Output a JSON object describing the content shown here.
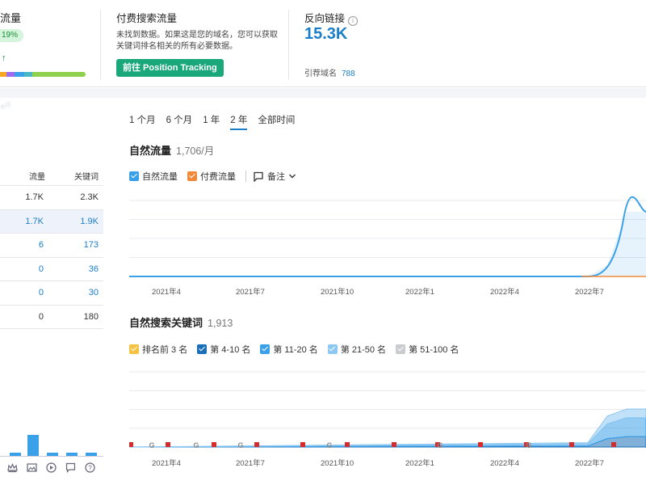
{
  "metrics": {
    "m1": {
      "title": "流量",
      "pct": "19%",
      "arrow": "↑",
      "stack_colors": [
        "#f5a623",
        "#9b6cf2",
        "#3aa0e8",
        "#48b8c8",
        "#8fd14f",
        "#8fd14f"
      ]
    },
    "m2": {
      "title": "付费搜索流量",
      "desc": "未找到数据。如果这是您的域名，您可以获取关键词排名相关的所有必要数据。",
      "button": "前往 Position Tracking"
    },
    "m3": {
      "title": "反向链接",
      "value": "15.3K",
      "ref_label": "引荐域名",
      "ref_value": "788"
    }
  },
  "left_table": {
    "headers": [
      "流量",
      "关键词"
    ],
    "rows": [
      {
        "traffic": "1.7K",
        "keywords": "2.3K"
      },
      {
        "traffic": "1.7K",
        "keywords": "1.9K"
      },
      {
        "traffic": "6",
        "keywords": "173"
      },
      {
        "traffic": "0",
        "keywords": "36"
      },
      {
        "traffic": "0",
        "keywords": "30"
      },
      {
        "traffic": "0",
        "keywords": "180"
      }
    ]
  },
  "periods": [
    "1 个月",
    "6 个月",
    "1 年",
    "2 年",
    "全部时间"
  ],
  "active_period": "2 年",
  "traffic_chart": {
    "title": "自然流量",
    "value": "1,706/月",
    "legend": [
      "自然流量",
      "付费流量"
    ],
    "note_label": "备注",
    "colors": {
      "organic": "#3aa0e8",
      "paid": "#f08a3a"
    }
  },
  "keywords_chart": {
    "title": "自然搜索关键词",
    "value": "1,913",
    "legend": [
      "排名前 3 名",
      "第 4-10 名",
      "第 11-20 名",
      "第 21-50 名",
      "第 51-100 名"
    ],
    "legend_colors": [
      "#f5c242",
      "#1a6fb8",
      "#3aa0e8",
      "#8cc8f2",
      "#c8cbd0"
    ]
  },
  "chart_data": [
    {
      "type": "area",
      "title": "自然流量",
      "x": [
        "2021年4月",
        "2021年7月",
        "2021年10月",
        "2022年1月",
        "2022年4月",
        "2022年7月"
      ],
      "x_tick_labels": [
        "2021年4",
        "2021年7",
        "2021年10",
        "2022年1",
        "2022年4",
        "2022年7"
      ],
      "series": [
        {
          "name": "自然流量",
          "values": [
            0,
            0,
            0,
            0,
            0,
            0,
            0,
            0,
            0,
            0,
            0,
            0,
            0,
            0,
            0,
            0,
            0,
            0,
            0,
            0,
            20,
            300,
            1700,
            1706
          ]
        },
        {
          "name": "付费流量",
          "values": [
            0,
            0,
            0,
            0,
            0,
            0,
            0,
            0,
            0,
            0,
            0,
            0,
            0,
            0,
            0,
            0,
            0,
            0,
            0,
            0,
            0,
            0,
            0,
            0
          ]
        }
      ],
      "ylim": [
        0,
        2000
      ],
      "grid": true
    },
    {
      "type": "area",
      "title": "自然搜索关键词",
      "x_tick_labels": [
        "2021年4",
        "2021年7",
        "2021年10",
        "2022年1",
        "2022年4",
        "2022年7"
      ],
      "series": [
        {
          "name": "第 4-10 名",
          "values": [
            0,
            0,
            0,
            0,
            0,
            0,
            0,
            0,
            0,
            0,
            0,
            0,
            0,
            0,
            0,
            0,
            0,
            0,
            0,
            0,
            50,
            400,
            500,
            500
          ]
        },
        {
          "name": "第 11-20 名",
          "values": [
            0,
            0,
            0,
            0,
            0,
            0,
            0,
            0,
            0,
            0,
            0,
            0,
            0,
            0,
            0,
            0,
            0,
            0,
            0,
            0,
            100,
            700,
            900,
            900
          ]
        },
        {
          "name": "第 21-50 名",
          "values": [
            0,
            0,
            0,
            0,
            0,
            0,
            0,
            0,
            0,
            0,
            0,
            0,
            0,
            0,
            0,
            0,
            0,
            0,
            0,
            0,
            60,
            380,
            420,
            420
          ]
        }
      ],
      "markers": "flags-and-google-events",
      "grid": true
    }
  ]
}
